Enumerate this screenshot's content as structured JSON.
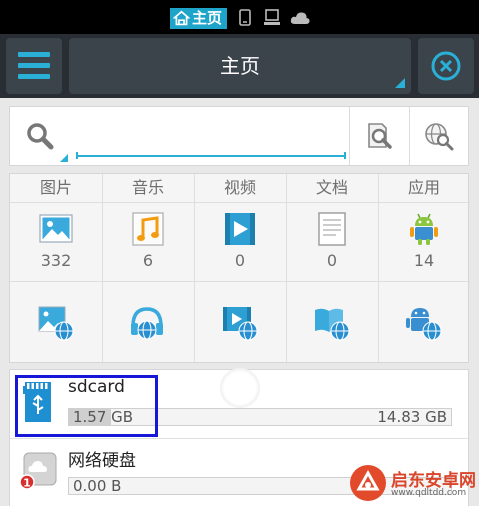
{
  "status_bar": {
    "tab_label": "主页"
  },
  "action_bar": {
    "title": "主页"
  },
  "search": {
    "placeholder": "",
    "value": ""
  },
  "categories": [
    {
      "label": "图片",
      "count": "332",
      "icon": "image-icon"
    },
    {
      "label": "音乐",
      "count": "6",
      "icon": "music-note-icon"
    },
    {
      "label": "视频",
      "count": "0",
      "icon": "video-play-icon"
    },
    {
      "label": "文档",
      "count": "0",
      "icon": "document-icon"
    },
    {
      "label": "应用",
      "count": "14",
      "icon": "android-icon"
    }
  ],
  "network_tools": [
    {
      "icon": "network-image-icon"
    },
    {
      "icon": "network-music-icon"
    },
    {
      "icon": "network-video-icon"
    },
    {
      "icon": "network-book-icon"
    },
    {
      "icon": "network-android-icon"
    }
  ],
  "storage": [
    {
      "name": "sdcard",
      "used": "1.57 GB",
      "total": "14.83 GB",
      "used_fraction": 0.106
    },
    {
      "name": "网络硬盘",
      "used": "0.00 B",
      "total": "",
      "used_fraction": 0,
      "badge": "1"
    }
  ],
  "watermark": {
    "title": "启东安卓网",
    "url": "www.qdltdd.com"
  },
  "colors": {
    "accent": "#2ab0d6",
    "status_bar": "#000000",
    "action_bar": "#282e34",
    "highlight": "#1717d8"
  }
}
